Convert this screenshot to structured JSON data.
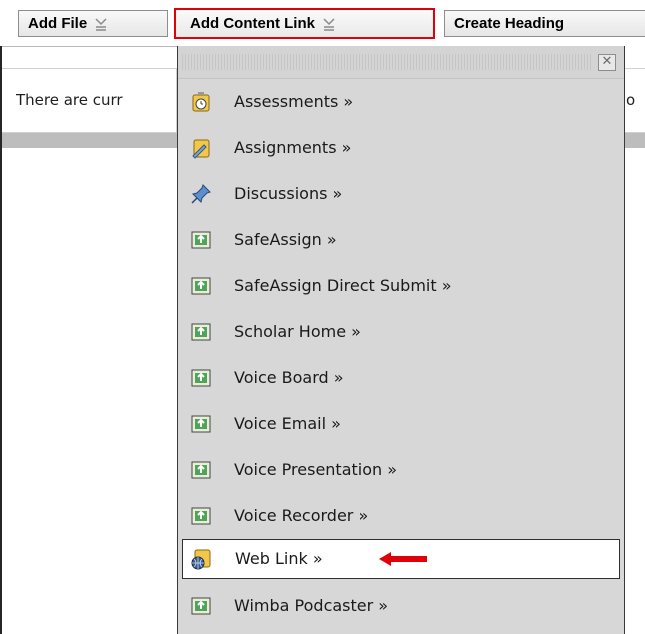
{
  "toolbar": {
    "add_file_label": "Add File",
    "add_content_link_label": "Add Content Link",
    "create_heading_label": "Create Heading"
  },
  "page": {
    "message_left": "There are curr",
    "message_right": "o"
  },
  "menu": {
    "close_symbol": "✕",
    "items": [
      {
        "label": "Assessments »",
        "icon": "assessment-icon"
      },
      {
        "label": "Assignments »",
        "icon": "assignment-icon"
      },
      {
        "label": "Discussions »",
        "icon": "pushpin-icon"
      },
      {
        "label": "SafeAssign »",
        "icon": "tool-icon"
      },
      {
        "label": "SafeAssign Direct Submit »",
        "icon": "tool-icon"
      },
      {
        "label": "Scholar Home »",
        "icon": "tool-icon"
      },
      {
        "label": "Voice Board »",
        "icon": "tool-icon"
      },
      {
        "label": "Voice Email »",
        "icon": "tool-icon"
      },
      {
        "label": "Voice Presentation »",
        "icon": "tool-icon"
      },
      {
        "label": "Voice Recorder »",
        "icon": "tool-icon"
      },
      {
        "label": "Web Link »",
        "icon": "web-link-icon"
      },
      {
        "label": "Wimba Podcaster »",
        "icon": "tool-icon"
      }
    ]
  },
  "colors": {
    "highlight_border": "#e0000a",
    "arrow": "#e0000a",
    "menu_bg": "#d7d7d7"
  }
}
